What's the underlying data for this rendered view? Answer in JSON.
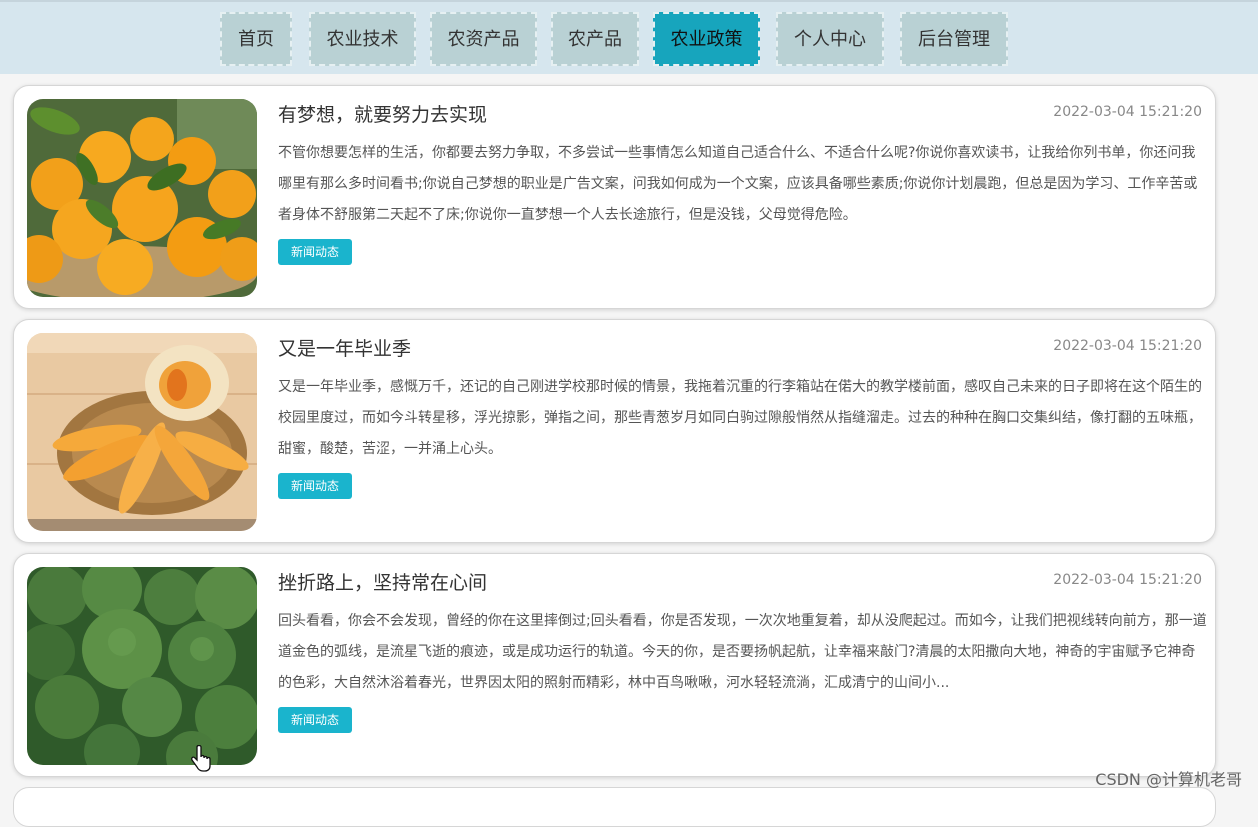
{
  "nav": {
    "items": [
      {
        "label": "首页"
      },
      {
        "label": "农业技术"
      },
      {
        "label": "农资产品"
      },
      {
        "label": "农产品"
      },
      {
        "label": "农业政策",
        "active": true
      },
      {
        "label": "个人中心"
      },
      {
        "label": "后台管理"
      }
    ]
  },
  "articles": [
    {
      "title": "有梦想，就要努力去实现",
      "date": "2022-03-04 15:21:20",
      "summary": "不管你想要怎样的生活，你都要去努力争取，不多尝试一些事情怎么知道自己适合什么、不适合什么呢?你说你喜欢读书，让我给你列书单，你还问我哪里有那么多时间看书;你说自己梦想的职业是广告文案，问我如何成为一个文案，应该具备哪些素质;你说你计划晨跑，但总是因为学习、工作辛苦或者身体不舒服第二天起不了床;你说你一直梦想一个人去长途旅行，但是没钱，父母觉得危险。",
      "tag": "新闻动态",
      "image": "oranges-photo"
    },
    {
      "title": "又是一年毕业季",
      "date": "2022-03-04 15:21:20",
      "summary": "又是一年毕业季，感慨万千，还记的自己刚进学校那时候的情景，我拖着沉重的行李箱站在偌大的教学楼前面，感叹自己未来的日子即将在这个陌生的校园里度过，而如今斗转星移，浮光掠影，弹指之间，那些青葱岁月如同白驹过隙般悄然从指缝溜走。过去的种种在胸口交集纠结，像打翻的五味瓶，甜蜜，酸楚，苦涩，一并涌上心头。",
      "tag": "新闻动态",
      "image": "melon-photo"
    },
    {
      "title": "挫折路上，坚持常在心间",
      "date": "2022-03-04 15:21:20",
      "summary": "回头看看，你会不会发现，曾经的你在这里摔倒过;回头看看，你是否发现，一次次地重复着，却从没爬起过。而如今，让我们把视线转向前方，那一道道金色的弧线，是流星飞逝的痕迹，或是成功运行的轨道。今天的你，是否要扬帆起航，让幸福来敲门?清晨的太阳撒向大地，神奇的宇宙赋予它神奇的色彩，大自然沐浴着春光，世界因太阳的照射而精彩，林中百鸟啾啾，河水轻轻流淌，汇成清宁的山间小...",
      "tag": "新闻动态",
      "image": "broccoli-photo"
    }
  ],
  "watermark": "CSDN @计算机老哥",
  "colors": {
    "nav_active": "#17a5bd",
    "nav_item": "#b9d1d4",
    "topbar": "#d6e6ee",
    "tag": "#1ab4cd"
  }
}
